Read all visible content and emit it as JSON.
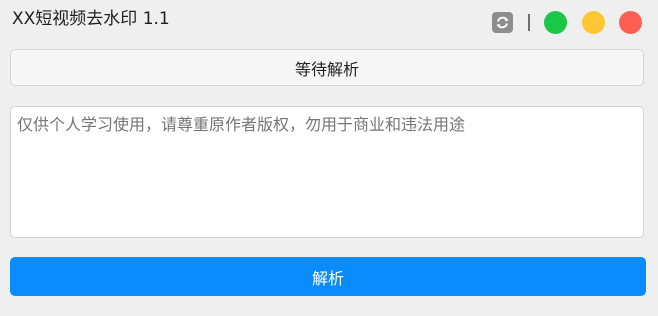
{
  "window": {
    "title": "XX短视频去水印 1.1",
    "controls": {
      "refresh_icon": "refresh-icon",
      "minimize_color": "#1bc746",
      "maximize_color": "#ffc733",
      "close_color": "#ff5f52"
    }
  },
  "status": {
    "text": "等待解析"
  },
  "input": {
    "placeholder": "仅供个人学习使用，请尊重原作者版权，勿用于商业和违法用途",
    "value": ""
  },
  "actions": {
    "parse_label": "解析",
    "accent_color": "#0a8cff"
  }
}
